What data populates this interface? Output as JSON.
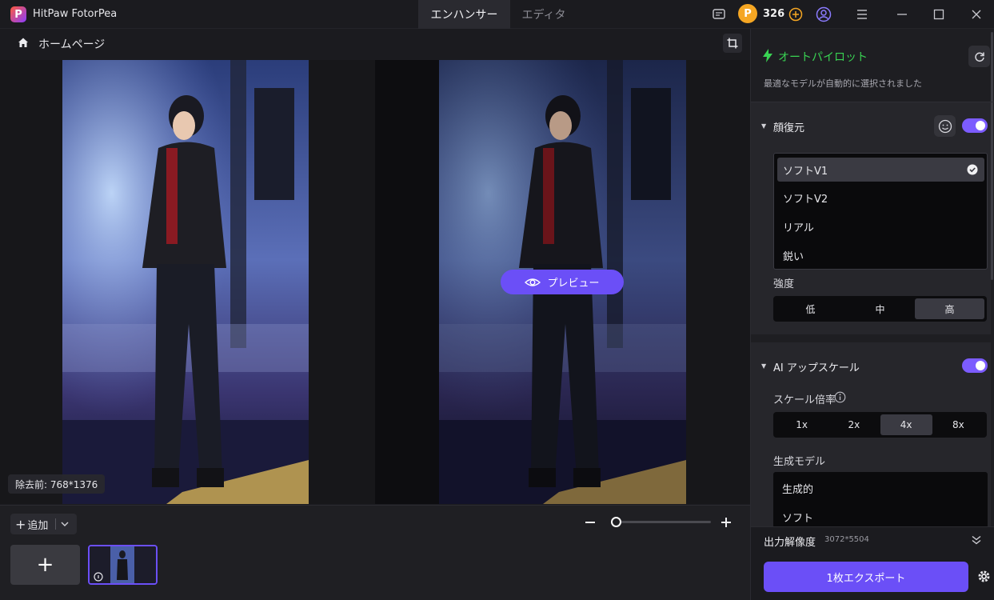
{
  "titlebar": {
    "logo_letter": "P",
    "app_title": "HitPaw FotorPea",
    "tabs": [
      {
        "label": "エンハンサー",
        "active": true
      },
      {
        "label": "エディタ",
        "active": false
      }
    ],
    "coin_letter": "P",
    "coins": "326",
    "icons": [
      "message-icon",
      "coin-icon",
      "add-coin-icon",
      "user-icon",
      "menu-icon",
      "minimize-icon",
      "maximize-icon",
      "close-icon"
    ]
  },
  "nav": {
    "home_label": "ホームページ"
  },
  "canvas": {
    "size_badge": "除去前: 768*1376",
    "preview_label": "プレビュー"
  },
  "bottom": {
    "add_label": "追加",
    "add_tile_symbol": "+",
    "zoom_level": 0.05
  },
  "panel": {
    "autopilot_label": "オートパイロット",
    "autopilot_desc": "最適なモデルが自動的に選択されました",
    "face": {
      "title": "顔復元",
      "enabled": true,
      "options": [
        "ソフトV1",
        "ソフトV2",
        "リアル",
        "鋭い"
      ],
      "selected": "ソフトV1",
      "strength_label": "強度",
      "strength_options": [
        "低",
        "中",
        "高"
      ],
      "strength_selected": "高"
    },
    "upscale": {
      "title": "AI アップスケール",
      "enabled": true,
      "scale_label": "スケール倍率",
      "scale_options": [
        "1x",
        "2x",
        "4x",
        "8x"
      ],
      "scale_selected": "4x",
      "model_label": "生成モデル",
      "model_options": [
        "生成的",
        "ソフト"
      ]
    },
    "output_label": "出力解像度",
    "output_value": "3072*5504",
    "export_label": "1枚エクスポート"
  },
  "colors": {
    "accent": "#6b4ff7",
    "autopilot_green": "#39d353",
    "toggle_on": "#7c5cff",
    "coin": "#f5a623"
  }
}
